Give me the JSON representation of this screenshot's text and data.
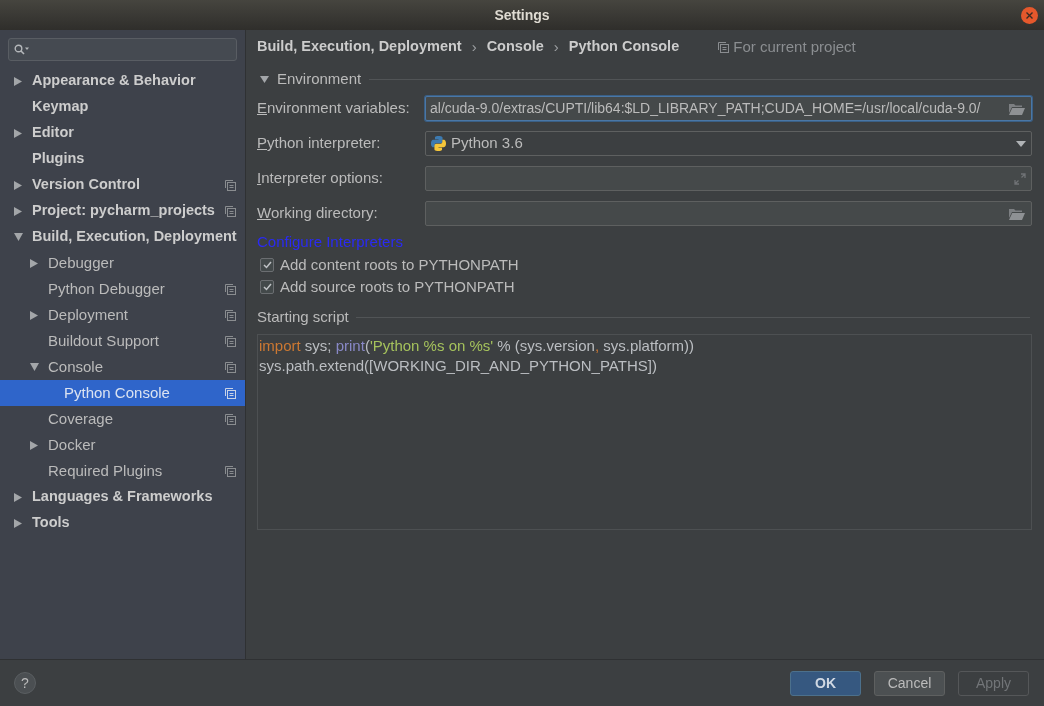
{
  "window": {
    "title": "Settings"
  },
  "sidebar": {
    "items": [
      {
        "kind": "node",
        "label": "Appearance & Behavior",
        "expanded": false,
        "selected": false,
        "project_level": false
      },
      {
        "kind": "leaf",
        "label": "Keymap",
        "selected": false,
        "project_level": false
      },
      {
        "kind": "node",
        "label": "Editor",
        "expanded": false,
        "selected": false,
        "project_level": false
      },
      {
        "kind": "leaf",
        "label": "Plugins",
        "selected": false,
        "project_level": false
      },
      {
        "kind": "node",
        "label": "Version Control",
        "expanded": false,
        "selected": false,
        "project_level": true
      },
      {
        "kind": "node",
        "label": "Project: pycharm_projects",
        "expanded": false,
        "selected": false,
        "project_level": true
      },
      {
        "kind": "node",
        "label": "Build, Execution, Deployment",
        "expanded": true,
        "selected": false,
        "project_level": false,
        "children": [
          {
            "kind": "node",
            "label": "Debugger",
            "expanded": false,
            "selected": false,
            "project_level": false
          },
          {
            "kind": "leaf",
            "label": "Python Debugger",
            "selected": false,
            "project_level": true
          },
          {
            "kind": "node",
            "label": "Deployment",
            "expanded": false,
            "selected": false,
            "project_level": true
          },
          {
            "kind": "leaf",
            "label": "Buildout Support",
            "selected": false,
            "project_level": true
          },
          {
            "kind": "node",
            "label": "Console",
            "expanded": true,
            "selected": false,
            "project_level": true,
            "children": [
              {
                "kind": "leaf",
                "label": "Python Console",
                "selected": true,
                "project_level": true
              }
            ]
          },
          {
            "kind": "leaf",
            "label": "Coverage",
            "selected": false,
            "project_level": true
          },
          {
            "kind": "node",
            "label": "Docker",
            "expanded": false,
            "selected": false,
            "project_level": false
          },
          {
            "kind": "leaf",
            "label": "Required Plugins",
            "selected": false,
            "project_level": true
          }
        ]
      },
      {
        "kind": "node",
        "label": "Languages & Frameworks",
        "expanded": false,
        "selected": false,
        "project_level": false
      },
      {
        "kind": "node",
        "label": "Tools",
        "expanded": false,
        "selected": false,
        "project_level": false
      }
    ]
  },
  "breadcrumb": [
    {
      "kind": "crumb",
      "text": "Build, Execution, Deployment"
    },
    {
      "kind": "separator",
      "text": "›"
    },
    {
      "kind": "crumb",
      "text": "Console"
    },
    {
      "kind": "separator",
      "text": "›"
    },
    {
      "kind": "crumb",
      "text": "Python Console"
    }
  ],
  "scope": {
    "label": "For current project"
  },
  "environment": {
    "title": "Environment",
    "expanded": true,
    "fields": [
      {
        "kind": "browse",
        "label": "Environment variables:",
        "mnemonic": true,
        "focused": true,
        "value": "al/cuda-9.0/extras/CUPTI/lib64:$LD_LIBRARY_PATH;CUDA_HOME=/usr/local/cuda-9.0/"
      },
      {
        "kind": "select",
        "label": "Python interpreter:",
        "mnemonic": true,
        "focused": false,
        "value": "Python 3.6"
      },
      {
        "kind": "expand",
        "label": "Interpreter options:",
        "mnemonic": true,
        "focused": false
      },
      {
        "kind": "browse",
        "label": "Working directory:",
        "mnemonic": true,
        "focused": false
      }
    ],
    "link": "Configure Interpreters",
    "checkboxes": [
      {
        "label": "Add content roots to PYTHONPATH",
        "checked": true
      },
      {
        "label": "Add source roots to PYTHONPATH",
        "checked": true
      }
    ]
  },
  "starting_script": {
    "title": "Starting script",
    "lines": [
      [
        {
          "kind": "keyword",
          "text": "import"
        },
        {
          "kind": "plain",
          "text": " sys; "
        },
        {
          "kind": "builtin",
          "text": "print"
        },
        {
          "kind": "plain",
          "text": "("
        },
        {
          "kind": "string",
          "text": "'Python %s on %s'"
        },
        {
          "kind": "plain",
          "text": " % (sys.version"
        },
        {
          "kind": "punct",
          "text": ","
        },
        {
          "kind": "plain",
          "text": " sys.platform))"
        }
      ],
      [
        {
          "kind": "plain",
          "text": "sys.path.extend([WORKING_DIR_AND_PYTHON_PATHS])"
        }
      ]
    ]
  },
  "footer": {
    "help": "?",
    "buttons": [
      {
        "label": "OK",
        "default": true,
        "disabled": false
      },
      {
        "label": "Cancel",
        "default": false,
        "disabled": false
      },
      {
        "label": "Apply",
        "default": false,
        "disabled": true
      }
    ]
  }
}
